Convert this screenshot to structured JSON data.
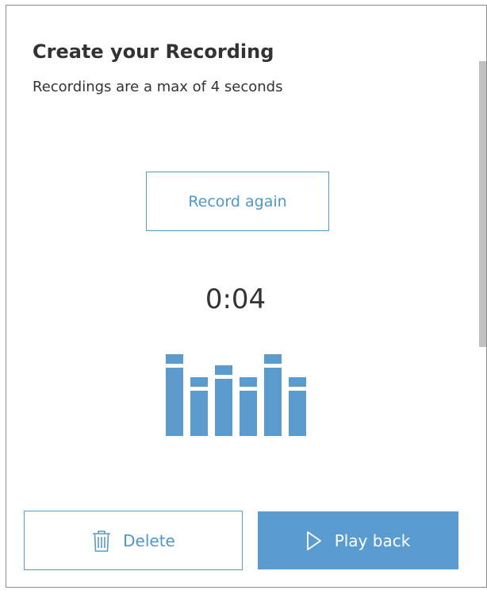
{
  "dialog": {
    "title": "Create your Recording",
    "subtitle": "Recordings are a max of 4 seconds",
    "record_again_label": "Record again",
    "timer": "0:04",
    "delete_label": "Delete",
    "play_back_label": "Play back",
    "delete_icon": "trash-icon",
    "play_icon": "play-icon"
  },
  "waveform": {
    "color": "#5b9bce",
    "bar_levels": [
      1.0,
      0.72,
      0.86,
      0.72,
      1.0,
      0.72
    ]
  },
  "colors": {
    "accent": "#5a9ccf",
    "accent_text": "#4e97c7",
    "text": "#333333"
  }
}
